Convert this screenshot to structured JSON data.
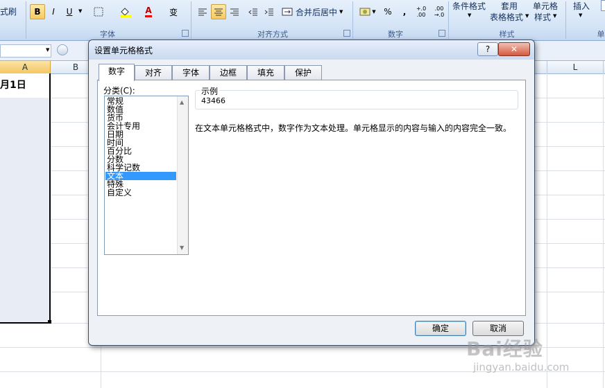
{
  "ribbon": {
    "format_painter": "式刷",
    "bold": "B",
    "italic": "I",
    "underline": "U",
    "font_color_glyph": "A",
    "wen_glyph": "变",
    "group_font": "字体",
    "group_align": "对齐方式",
    "merge_center": "合并后居中",
    "percent": "%",
    "comma": ",",
    "inc_dec": "+.0 .00",
    "dec_dec": ".00 →.0",
    "group_number": "数字",
    "cond_format": "条件格式",
    "table_format": "表格格式",
    "apply": "套用",
    "cell_style": "单元格",
    "style": "样式",
    "group_style": "样式",
    "insert": "插入",
    "group_cells_partial": "单"
  },
  "grid": {
    "columns": [
      "A",
      "B",
      "L"
    ],
    "cell_a1": "月1日"
  },
  "dialog": {
    "title": "设置单元格格式",
    "help": "?",
    "close": "✕",
    "tabs": [
      "数字",
      "对齐",
      "字体",
      "边框",
      "填充",
      "保护"
    ],
    "category_label": "分类(C):",
    "categories": [
      "常规",
      "数值",
      "货币",
      "会计专用",
      "日期",
      "时间",
      "百分比",
      "分数",
      "科学记数",
      "文本",
      "特殊",
      "自定义"
    ],
    "selected_category": "文本",
    "sample_label": "示例",
    "sample_value": "43466",
    "description": "在文本单元格格式中，数字作为文本处理。单元格显示的内容与输入的内容完全一致。",
    "ok": "确定",
    "cancel": "取消"
  },
  "watermark": {
    "brand": "Bai经验",
    "url": "jingyan.baidu.com"
  },
  "colors": {
    "accent": "#3399ff",
    "ribbon": "#d3e3f6"
  }
}
